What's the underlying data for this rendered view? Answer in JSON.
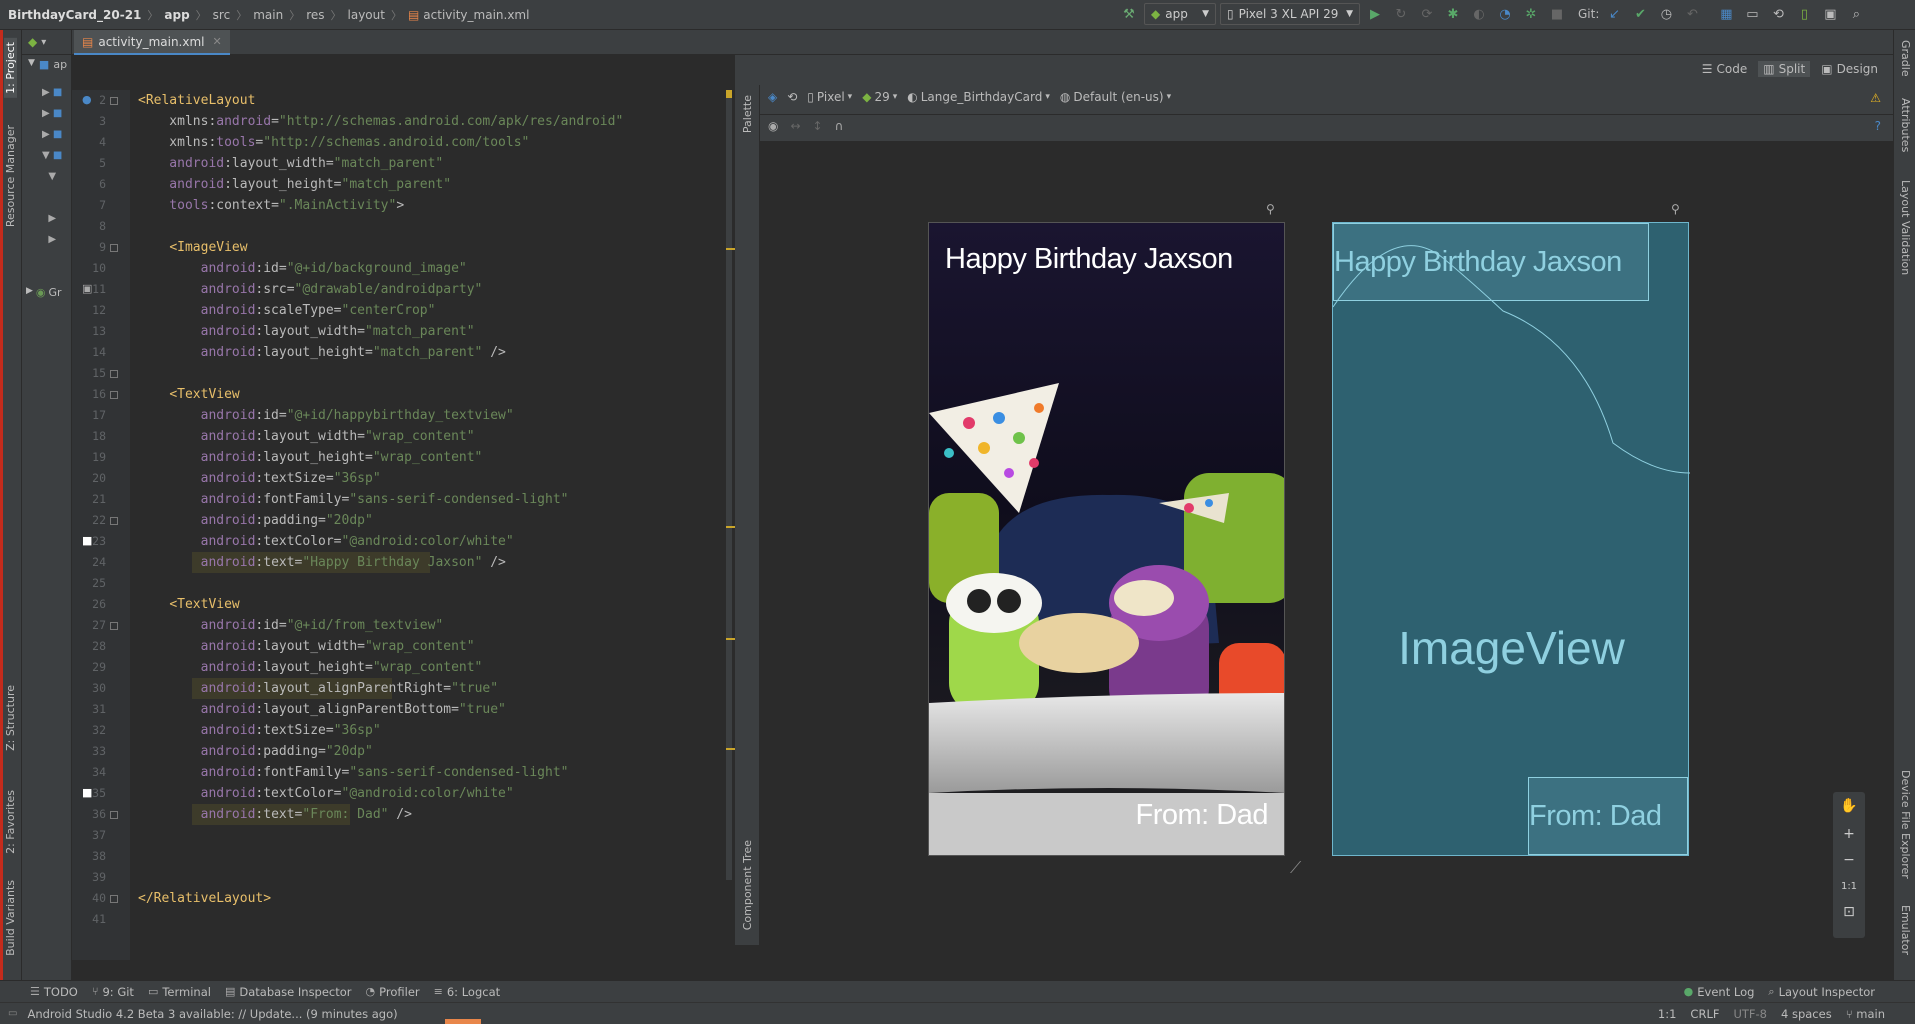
{
  "breadcrumb": [
    "BirthdayCard_20-21",
    "app",
    "src",
    "main",
    "res",
    "layout",
    "activity_main.xml"
  ],
  "toolbar": {
    "run_config": "app",
    "device": "Pixel 3 XL API 29",
    "git_label": "Git:"
  },
  "tabs": [
    {
      "label": "activity_main.xml"
    }
  ],
  "project_pane": {
    "root_label": "ap",
    "gr_label": "Gr"
  },
  "view_modes": {
    "code": "Code",
    "split": "Split",
    "design": "Design"
  },
  "design_toolbar": {
    "device": "Pixel",
    "api": "29",
    "theme": "Lange_BirthdayCard",
    "locale": "Default (en-us)"
  },
  "code_lines": [
    {
      "n": "2",
      "parts": [
        [
          "tag",
          "<RelativeLayout"
        ]
      ]
    },
    {
      "n": "3",
      "parts": [
        [
          "attr",
          "    xmlns:"
        ],
        [
          "ns",
          "android"
        ],
        [
          "attr",
          "="
        ],
        [
          "val",
          "\"http://schemas.android.com/apk/res/android\""
        ]
      ]
    },
    {
      "n": "4",
      "parts": [
        [
          "attr",
          "    xmlns:"
        ],
        [
          "ns",
          "tools"
        ],
        [
          "attr",
          "="
        ],
        [
          "val",
          "\"http://schemas.android.com/tools\""
        ]
      ]
    },
    {
      "n": "5",
      "parts": [
        [
          "ns",
          "    android"
        ],
        [
          "attr",
          ":layout_width="
        ],
        [
          "val",
          "\"match_parent\""
        ]
      ]
    },
    {
      "n": "6",
      "parts": [
        [
          "ns",
          "    android"
        ],
        [
          "attr",
          ":layout_height="
        ],
        [
          "val",
          "\"match_parent\""
        ]
      ]
    },
    {
      "n": "7",
      "parts": [
        [
          "ns",
          "    tools"
        ],
        [
          "attr",
          ":context="
        ],
        [
          "val",
          "\".MainActivity\""
        ],
        [
          "attr",
          ">"
        ]
      ]
    },
    {
      "n": "8",
      "parts": []
    },
    {
      "n": "9",
      "parts": [
        [
          "attr",
          "    "
        ],
        [
          "tag",
          "<ImageView"
        ]
      ]
    },
    {
      "n": "10",
      "parts": [
        [
          "ns",
          "        android"
        ],
        [
          "attr",
          ":id="
        ],
        [
          "val",
          "\"@+id/background_image\""
        ]
      ]
    },
    {
      "n": "11",
      "parts": [
        [
          "ns",
          "        android"
        ],
        [
          "attr",
          ":src="
        ],
        [
          "val",
          "\"@drawable/androidparty\""
        ]
      ]
    },
    {
      "n": "12",
      "parts": [
        [
          "ns",
          "        android"
        ],
        [
          "attr",
          ":scaleType="
        ],
        [
          "val",
          "\"centerCrop\""
        ]
      ]
    },
    {
      "n": "13",
      "parts": [
        [
          "ns",
          "        android"
        ],
        [
          "attr",
          ":layout_width="
        ],
        [
          "val",
          "\"match_parent\""
        ]
      ]
    },
    {
      "n": "14",
      "parts": [
        [
          "ns",
          "        android"
        ],
        [
          "attr",
          ":layout_height="
        ],
        [
          "val",
          "\"match_parent\""
        ],
        [
          "attr",
          " />"
        ]
      ]
    },
    {
      "n": "15",
      "parts": []
    },
    {
      "n": "16",
      "parts": [
        [
          "attr",
          "    "
        ],
        [
          "tag",
          "<TextView"
        ]
      ]
    },
    {
      "n": "17",
      "parts": [
        [
          "ns",
          "        android"
        ],
        [
          "attr",
          ":id="
        ],
        [
          "val",
          "\"@+id/happybirthday_textview\""
        ]
      ]
    },
    {
      "n": "18",
      "parts": [
        [
          "ns",
          "        android"
        ],
        [
          "attr",
          ":layout_width="
        ],
        [
          "val",
          "\"wrap_content\""
        ]
      ]
    },
    {
      "n": "19",
      "parts": [
        [
          "ns",
          "        android"
        ],
        [
          "attr",
          ":layout_height="
        ],
        [
          "val",
          "\"wrap_content\""
        ]
      ]
    },
    {
      "n": "20",
      "parts": [
        [
          "ns",
          "        android"
        ],
        [
          "attr",
          ":textSize="
        ],
        [
          "val",
          "\"36sp\""
        ]
      ]
    },
    {
      "n": "21",
      "parts": [
        [
          "ns",
          "        android"
        ],
        [
          "attr",
          ":fontFamily="
        ],
        [
          "val",
          "\"sans-serif-condensed-light\""
        ]
      ]
    },
    {
      "n": "22",
      "parts": [
        [
          "ns",
          "        android"
        ],
        [
          "attr",
          ":padding="
        ],
        [
          "val",
          "\"20dp\""
        ]
      ]
    },
    {
      "n": "23",
      "parts": [
        [
          "ns",
          "        android"
        ],
        [
          "attr",
          ":textColor="
        ],
        [
          "val",
          "\"@android:color/white\""
        ]
      ]
    },
    {
      "n": "24",
      "parts": [
        [
          "attr",
          "        "
        ],
        [
          "ns",
          "android"
        ],
        [
          "attr",
          ":text="
        ],
        [
          "val",
          "\"Happy Birthday Jaxson\""
        ],
        [
          "attr",
          " />"
        ]
      ]
    },
    {
      "n": "25",
      "parts": []
    },
    {
      "n": "26",
      "parts": [
        [
          "attr",
          "    "
        ],
        [
          "tag",
          "<TextView"
        ]
      ]
    },
    {
      "n": "27",
      "parts": [
        [
          "ns",
          "        android"
        ],
        [
          "attr",
          ":id="
        ],
        [
          "val",
          "\"@+id/from_textview\""
        ]
      ]
    },
    {
      "n": "28",
      "parts": [
        [
          "ns",
          "        android"
        ],
        [
          "attr",
          ":layout_width="
        ],
        [
          "val",
          "\"wrap_content\""
        ]
      ]
    },
    {
      "n": "29",
      "parts": [
        [
          "ns",
          "        android"
        ],
        [
          "attr",
          ":layout_height="
        ],
        [
          "val",
          "\"wrap_content\""
        ]
      ]
    },
    {
      "n": "30",
      "parts": [
        [
          "attr",
          "        "
        ],
        [
          "ns",
          "android"
        ],
        [
          "attr",
          ":layout_alignParentRight="
        ],
        [
          "val",
          "\"true\""
        ]
      ]
    },
    {
      "n": "31",
      "parts": [
        [
          "ns",
          "        android"
        ],
        [
          "attr",
          ":layout_alignParentBottom="
        ],
        [
          "val",
          "\"true\""
        ]
      ]
    },
    {
      "n": "32",
      "parts": [
        [
          "ns",
          "        android"
        ],
        [
          "attr",
          ":textSize="
        ],
        [
          "val",
          "\"36sp\""
        ]
      ]
    },
    {
      "n": "33",
      "parts": [
        [
          "ns",
          "        android"
        ],
        [
          "attr",
          ":padding="
        ],
        [
          "val",
          "\"20dp\""
        ]
      ]
    },
    {
      "n": "34",
      "parts": [
        [
          "ns",
          "        android"
        ],
        [
          "attr",
          ":fontFamily="
        ],
        [
          "val",
          "\"sans-serif-condensed-light\""
        ]
      ]
    },
    {
      "n": "35",
      "parts": [
        [
          "ns",
          "        android"
        ],
        [
          "attr",
          ":textColor="
        ],
        [
          "val",
          "\"@android:color/white\""
        ]
      ]
    },
    {
      "n": "36",
      "parts": [
        [
          "attr",
          "        "
        ],
        [
          "ns",
          "android"
        ],
        [
          "attr",
          ":text="
        ],
        [
          "val",
          "\"From: Dad\""
        ],
        [
          "attr",
          " />"
        ]
      ]
    },
    {
      "n": "37",
      "parts": []
    },
    {
      "n": "38",
      "parts": []
    },
    {
      "n": "39",
      "parts": []
    },
    {
      "n": "40",
      "parts": [
        [
          "tag",
          "</RelativeLayout>"
        ]
      ]
    },
    {
      "n": "41",
      "parts": []
    }
  ],
  "preview": {
    "happy_text": "Happy Birthday Jaxson",
    "from_text": "From: Dad",
    "blueprint_label": "ImageView",
    "zoom_fit": "1:1"
  },
  "left_tools": {
    "project": "1: Project",
    "resource_manager": "Resource Manager",
    "structure": "Z: Structure",
    "favorites": "2: Favorites",
    "build_variants": "Build Variants"
  },
  "right_tools": {
    "gradle": "Gradle",
    "attributes": "Attributes",
    "layout_validation": "Layout Validation",
    "device_file_explorer": "Device File Explorer",
    "emulator": "Emulator"
  },
  "side_panels": {
    "palette": "Palette",
    "component_tree": "Component Tree"
  },
  "bottom_tools": [
    "TODO",
    "9: Git",
    "Terminal",
    "Database Inspector",
    "Profiler",
    "6: Logcat"
  ],
  "bottom_right_tools": [
    "Event Log",
    "Layout Inspector"
  ],
  "status": {
    "message": "Android Studio 4.2 Beta 3 available: // Update... (9 minutes ago)",
    "position": "1:1",
    "line_sep": "CRLF",
    "encoding": "UTF-8",
    "indent": "4 spaces",
    "branch": "main"
  },
  "colors": {
    "accent": "#4a88c7",
    "blueprint": "#2e6170",
    "tag": "#e8bf6a",
    "value": "#6a8759",
    "namespace": "#9876aa"
  }
}
